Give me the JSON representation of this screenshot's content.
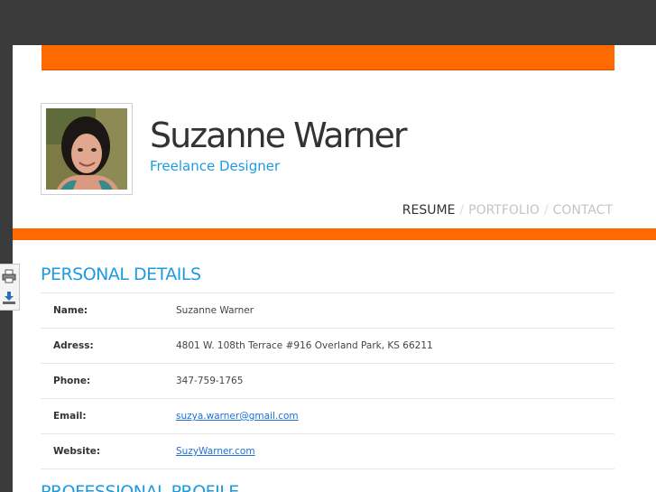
{
  "header": {
    "name": "Suzanne Warner",
    "subtitle": "Freelance Designer"
  },
  "nav": {
    "items": [
      {
        "label": "RESUME",
        "active": true
      },
      {
        "label": "PORTFOLIO",
        "active": false
      },
      {
        "label": "CONTACT",
        "active": false
      }
    ],
    "separator": "/"
  },
  "personal_details": {
    "title": "PERSONAL DETAILS",
    "rows": [
      {
        "label": "Name:",
        "value": "Suzanne Warner"
      },
      {
        "label": "Adress:",
        "value": "4801 W. 108th Terrace #916 Overland Park, KS 66211"
      },
      {
        "label": "Phone:",
        "value": "347-759-1765"
      },
      {
        "label": "Email:",
        "value": "suzya.warner@gmail.com"
      },
      {
        "label": "Website:",
        "value": "SuzyWarner.com"
      }
    ]
  },
  "next_section": {
    "title": "PROFESSIONAL PROFILE"
  },
  "side_tools": {
    "items": [
      "print-icon",
      "download-icon"
    ]
  },
  "colors": {
    "accent_orange": "#ff6a00",
    "accent_blue": "#1e9be0",
    "page_bg": "#3b3b3b"
  }
}
